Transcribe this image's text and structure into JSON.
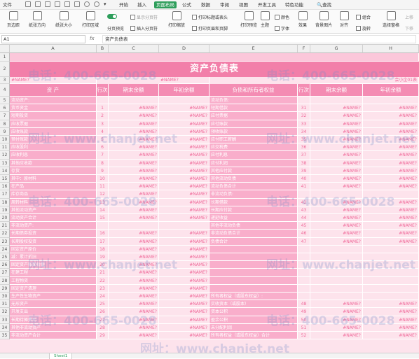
{
  "menu": {
    "file": "文件",
    "tabs": [
      "开始",
      "插入",
      "页面布局",
      "公式",
      "数据",
      "审阅",
      "视图",
      "开发工具",
      "特色功能"
    ],
    "active_tab": "页面布局",
    "search": "查找"
  },
  "ribbon": {
    "margins": "页边距",
    "orientation": "纸张方向",
    "size": "纸张大小",
    "print_area": "打印区域",
    "page_break_preview": "分页预览",
    "insert_page_break": "插入分页符",
    "show_page_break": "显示分页符",
    "print_scale": "打印缩放",
    "print_title": "打印标题或表头",
    "print_header_footer": "打印页眉和页脚",
    "print_preview": "打印预览",
    "theme": "主题",
    "colors": "颜色",
    "fonts": "字体",
    "effects": "效果",
    "background": "背景图片",
    "align": "对齐",
    "group": "组合",
    "rotate": "旋转",
    "selection_pane": "选择窗格",
    "move_up": "上移",
    "move_down": "下移"
  },
  "formula_bar": {
    "name_box": "A1",
    "fx": "fx",
    "value": "资产负债表"
  },
  "columns": [
    "A",
    "B",
    "C",
    "D",
    "E",
    "F",
    "G",
    "H"
  ],
  "sheet": {
    "title": "资产负债表",
    "name_left": "#NAME?",
    "name_mid": "#NAME?",
    "unit": "会小企01表",
    "headers": {
      "assets": "资    产",
      "row_no": "行次",
      "end_balance": "期末余额",
      "begin_balance": "年初余额",
      "liabilities": "负债和所有者权益",
      "row_no2": "行次",
      "end_balance2": "期末余额",
      "begin_balance2": "年初余额"
    },
    "rows": [
      {
        "r": "5",
        "a": "流动资产:",
        "b": "",
        "c": "",
        "d": "",
        "e": "流动负债:",
        "f": "",
        "g": "",
        "h": ""
      },
      {
        "r": "6",
        "a": "货币资金",
        "b": "1",
        "c": "#NAME?",
        "d": "#NAME?",
        "e": "短期借款",
        "f": "31",
        "g": "#NAME?",
        "h": "#NAME?"
      },
      {
        "r": "7",
        "a": "短期投资",
        "b": "2",
        "c": "#NAME?",
        "d": "#NAME?",
        "e": "应付票据",
        "f": "32",
        "g": "#NAME?",
        "h": "#NAME?"
      },
      {
        "r": "8",
        "a": "应收票据",
        "b": "3",
        "c": "#NAME?",
        "d": "#NAME?",
        "e": "应付账款",
        "f": "33",
        "g": "#NAME?",
        "h": "#NAME?"
      },
      {
        "r": "9",
        "a": "应收账款",
        "b": "4",
        "c": "#NAME?",
        "d": "#NAME?",
        "e": "预收账款",
        "f": "34",
        "g": "#NAME?",
        "h": "#NAME?"
      },
      {
        "r": "10",
        "a": "预付账款",
        "b": "5",
        "c": "#NAME?",
        "d": "#NAME?",
        "e": "应付职工薪酬",
        "f": "35",
        "g": "#NAME?",
        "h": "#NAME?"
      },
      {
        "r": "11",
        "a": "应收股利",
        "b": "6",
        "c": "#NAME?",
        "d": "#NAME?",
        "e": "应交税费",
        "f": "36",
        "g": "#NAME?",
        "h": "#NAME?"
      },
      {
        "r": "12",
        "a": "应收利息",
        "b": "7",
        "c": "#NAME?",
        "d": "#NAME?",
        "e": "应付利息",
        "f": "37",
        "g": "#NAME?",
        "h": "#NAME?"
      },
      {
        "r": "13",
        "a": "其他应收款",
        "b": "8",
        "c": "#NAME?",
        "d": "#NAME?",
        "e": "应付利润",
        "f": "38",
        "g": "#NAME?",
        "h": "#NAME?"
      },
      {
        "r": "14",
        "a": "存货",
        "b": "9",
        "c": "#NAME?",
        "d": "#NAME?",
        "e": "其他应付款",
        "f": "39",
        "g": "#NAME?",
        "h": "#NAME?"
      },
      {
        "r": "15",
        "a": "其中：原材料",
        "b": "10",
        "c": "#NAME?",
        "d": "#NAME?",
        "e": "其他流动负债",
        "f": "40",
        "g": "#NAME?",
        "h": "#NAME?"
      },
      {
        "r": "16",
        "a": "在产品",
        "b": "11",
        "c": "#NAME?",
        "d": "#NAME?",
        "e": "流动负债合计",
        "f": "41",
        "g": "#NAME?",
        "h": "#NAME?"
      },
      {
        "r": "17",
        "a": "库存商品",
        "b": "12",
        "c": "#NAME?",
        "d": "#NAME?",
        "e": "非流动负债:",
        "f": "",
        "g": "",
        "h": ""
      },
      {
        "r": "18",
        "a": "周转材料",
        "b": "13",
        "c": "#NAME?",
        "d": "#NAME?",
        "e": "长期借款",
        "f": "42",
        "g": "#NAME?",
        "h": "#NAME?"
      },
      {
        "r": "19",
        "a": "其他流动资产",
        "b": "14",
        "c": "#NAME?",
        "d": "#NAME?",
        "e": "长期应付款",
        "f": "43",
        "g": "#NAME?",
        "h": "#NAME?"
      },
      {
        "r": "20",
        "a": "流动资产合计",
        "b": "15",
        "c": "#NAME?",
        "d": "#NAME?",
        "e": "递延收益",
        "f": "44",
        "g": "#NAME?",
        "h": "#NAME?"
      },
      {
        "r": "21",
        "a": "非流动资产:",
        "b": "",
        "c": "",
        "d": "",
        "e": "其他非流动负债",
        "f": "45",
        "g": "#NAME?",
        "h": "#NAME?"
      },
      {
        "r": "22",
        "a": "长期债券投资",
        "b": "16",
        "c": "#NAME?",
        "d": "#NAME?",
        "e": "非流动负债合计",
        "f": "46",
        "g": "#NAME?",
        "h": "#NAME?"
      },
      {
        "r": "23",
        "a": "长期股权投资",
        "b": "17",
        "c": "#NAME?",
        "d": "#NAME?",
        "e": "负债合计",
        "f": "47",
        "g": "#NAME?",
        "h": "#NAME?"
      },
      {
        "r": "24",
        "a": "固定资产原价",
        "b": "18",
        "c": "#NAME?",
        "d": "#NAME?",
        "e": "",
        "f": "",
        "g": "",
        "h": ""
      },
      {
        "r": "25",
        "a": "减：累计折旧",
        "b": "19",
        "c": "#NAME?",
        "d": "#NAME?",
        "e": "",
        "f": "",
        "g": "",
        "h": ""
      },
      {
        "r": "26",
        "a": "固定资产账面价值",
        "b": "20",
        "c": "#NAME?",
        "d": "#NAME?",
        "e": "",
        "f": "",
        "g": "",
        "h": ""
      },
      {
        "r": "27",
        "a": "在建工程",
        "b": "21",
        "c": "#NAME?",
        "d": "#NAME?",
        "e": "",
        "f": "",
        "g": "",
        "h": ""
      },
      {
        "r": "28",
        "a": "工程物资",
        "b": "22",
        "c": "#NAME?",
        "d": "#NAME?",
        "e": "",
        "f": "",
        "g": "",
        "h": ""
      },
      {
        "r": "29",
        "a": "固定资产清理",
        "b": "23",
        "c": "#NAME?",
        "d": "#NAME?",
        "e": "",
        "f": "",
        "g": "",
        "h": ""
      },
      {
        "r": "30",
        "a": "生产性生物资产",
        "b": "24",
        "c": "#NAME?",
        "d": "#NAME?",
        "e": "所有者权益（或股东权益）:",
        "f": "",
        "g": "",
        "h": ""
      },
      {
        "r": "31",
        "a": "无形资产",
        "b": "25",
        "c": "#NAME?",
        "d": "#NAME?",
        "e": "实收资本（或股本）",
        "f": "48",
        "g": "#NAME?",
        "h": "#NAME?"
      },
      {
        "r": "32",
        "a": "开发支出",
        "b": "26",
        "c": "#NAME?",
        "d": "#NAME?",
        "e": "资本公积",
        "f": "49",
        "g": "#NAME?",
        "h": "#NAME?"
      },
      {
        "r": "33",
        "a": "长期待摊费用",
        "b": "27",
        "c": "#NAME?",
        "d": "#NAME?",
        "e": "盈余公积",
        "f": "50",
        "g": "#NAME?",
        "h": "#NAME?"
      },
      {
        "r": "34",
        "a": "其他非流动资产",
        "b": "28",
        "c": "#NAME?",
        "d": "#NAME?",
        "e": "未分配利润",
        "f": "51",
        "g": "#NAME?",
        "h": "#NAME?"
      },
      {
        "r": "35",
        "a": "非流动资产合计",
        "b": "29",
        "c": "#NAME?",
        "d": "#NAME?",
        "e": "所有者权益（或股东权益）合计",
        "f": "52",
        "g": "#NAME?",
        "h": "#NAME?"
      }
    ]
  },
  "sheet_tab": "Sheet1",
  "watermark": {
    "phone": "电话：400-665-0028",
    "site": "网址：www.chanjet.net"
  }
}
